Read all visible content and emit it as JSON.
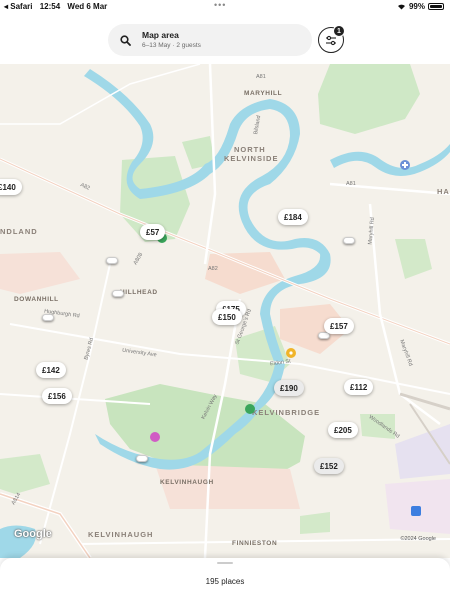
{
  "status_bar": {
    "back_app": "◂ Safari",
    "time": "12:54",
    "date": "Wed 6 Mar",
    "dots": "•••",
    "battery_text": "99%",
    "battery_level": 0.99
  },
  "search": {
    "title": "Map area",
    "subtitle": "6–13 May · 2 guests",
    "icon": "search-icon"
  },
  "filter": {
    "icon": "sliders-icon",
    "badge": "1"
  },
  "map": {
    "places": {
      "maryhill": "MARYHILL",
      "north_kelvinside_1": "NORTH",
      "north_kelvinside_2": "KELVINSIDE",
      "hillhead": "HILLHEAD",
      "dowanhill": "DOWANHILL",
      "kelvinbridge": "KELVINBRIDGE",
      "kelvinhaugh_upper": "KELVINHAUGH",
      "kelvinhaugh": "KELVINHAUGH",
      "finnieston": "FINNIESTON",
      "ndland": "NDLAND",
      "ha": "HA"
    },
    "roads": {
      "a81_top": "A81",
      "a81_right": "A81",
      "a82": "A82",
      "a82_left": "A82",
      "a808": "A808",
      "university_ave": "University Ave",
      "eldon_st": "Eldon St",
      "kelvin_way": "Kelvin Way",
      "maryhill_rd": "Maryhill Rd",
      "maryhill_rd_2": "Maryhill Rd",
      "byres_rd": "Byres Rd",
      "a814": "A814",
      "hughburgh_rd": "Hughburgh Rd",
      "woodlands_rd": "Woodlands Rd",
      "bilsland": "Bilsland",
      "st_georges": "St George's Rd"
    },
    "prices": [
      {
        "label": "£140",
        "visited": false
      },
      {
        "label": "£57",
        "visited": false
      },
      {
        "label": "£184",
        "visited": false
      },
      {
        "label": "£175",
        "visited": false
      },
      {
        "label": "£150",
        "visited": false
      },
      {
        "label": "£157",
        "visited": false
      },
      {
        "label": "£142",
        "visited": false
      },
      {
        "label": "£156",
        "visited": false
      },
      {
        "label": "£190",
        "visited": true
      },
      {
        "label": "£112",
        "visited": false
      },
      {
        "label": "£205",
        "visited": false
      },
      {
        "label": "£152",
        "visited": true
      }
    ],
    "google": "Google",
    "copyright": "©2024 Google"
  },
  "bottom_sheet": {
    "count": "195 places"
  }
}
